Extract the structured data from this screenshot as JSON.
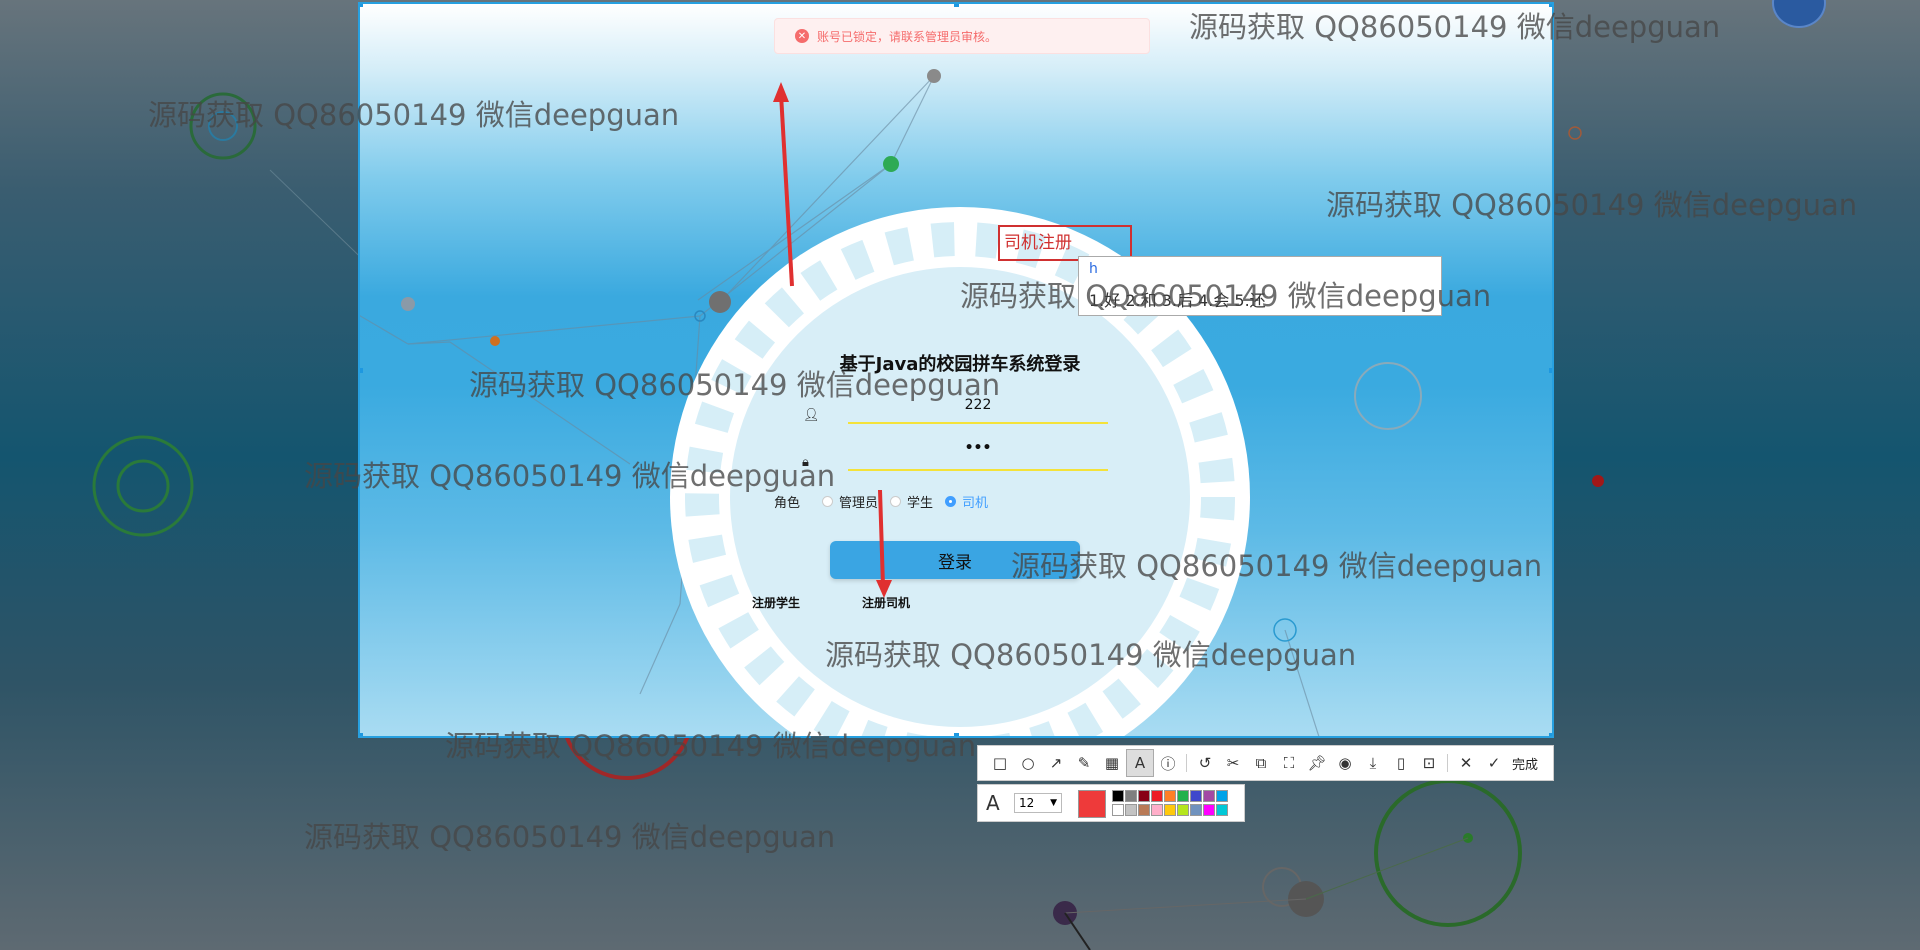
{
  "alert": {
    "message": "账号已锁定，请联系管理员审核。"
  },
  "login": {
    "title": "基于Java的校园拼车系统登录",
    "username_value": "222",
    "password_value": "•••",
    "role_label": "角色",
    "roles": [
      "管理员",
      "学生",
      "司机"
    ],
    "selected_role": "司机",
    "login_button": "登录",
    "register_student": "注册学生",
    "register_driver": "注册司机"
  },
  "annotation": {
    "text_box": "司机注册",
    "ime_composition": "h",
    "ime_candidates": "1.好 2.和 3.后 4.会 5.还"
  },
  "watermark": "源码获取 QQ86050149 微信deepguan",
  "toolbar": {
    "done_label": "完成",
    "font_size": "12",
    "tools": [
      "rectangle-icon",
      "ellipse-icon",
      "arrow-icon",
      "pencil-icon",
      "mosaic-icon",
      "text-icon",
      "number-icon",
      "undo-icon",
      "scissor-icon",
      "copy-icon",
      "ocr-icon",
      "pin-icon",
      "record-icon",
      "save-icon",
      "phone-icon",
      "bookmark-icon",
      "close-icon",
      "check-icon"
    ],
    "colors": {
      "current": "#ee3a3a",
      "palette_top": [
        "#000000",
        "#7f7f7f",
        "#880015",
        "#ed1c24",
        "#ff7f27",
        "#22b14c",
        "#3f48cc",
        "#a349a4",
        "#00a2e8"
      ],
      "palette_bottom": [
        "#ffffff",
        "#c3c3c3",
        "#b97a57",
        "#ffaec9",
        "#ffc90e",
        "#b5e61d",
        "#7092be",
        "#ff00ff",
        "#00c8d7"
      ]
    }
  }
}
